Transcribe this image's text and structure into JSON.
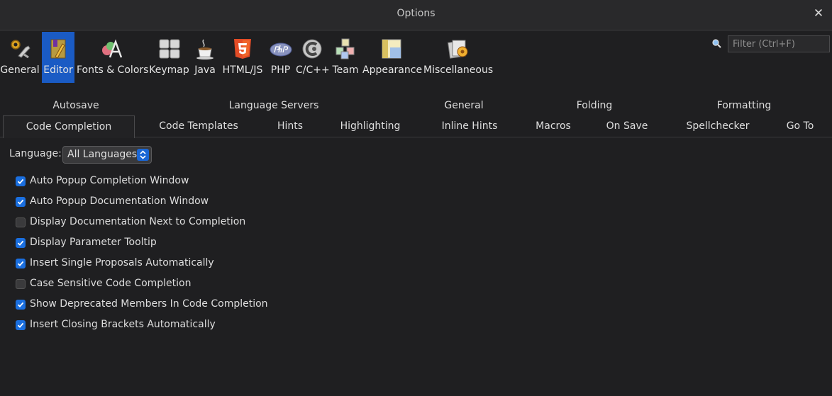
{
  "window": {
    "title": "Options",
    "close_glyph": "✕"
  },
  "toolbar": {
    "categories": [
      {
        "label": "General",
        "icon": "wrench-gear-icon"
      },
      {
        "label": "Editor",
        "icon": "editor-book-icon",
        "selected": true
      },
      {
        "label": "Fonts & Colors",
        "icon": "font-palette-icon"
      },
      {
        "label": "Keymap",
        "icon": "keyboard-icon"
      },
      {
        "label": "Java",
        "icon": "java-cup-icon"
      },
      {
        "label": "HTML/JS",
        "icon": "html5-icon"
      },
      {
        "label": "PHP",
        "icon": "php-icon"
      },
      {
        "label": "C/C++",
        "icon": "cpp-icon"
      },
      {
        "label": "Team",
        "icon": "team-cubes-icon"
      },
      {
        "label": "Appearance",
        "icon": "appearance-layout-icon"
      },
      {
        "label": "Miscellaneous",
        "icon": "misc-cards-icon"
      }
    ],
    "filter_placeholder": "Filter (Ctrl+F)"
  },
  "tabs": {
    "row1": [
      "Autosave",
      "Language Servers",
      "General",
      "Folding",
      "Formatting"
    ],
    "row2": [
      "Code Completion",
      "Code Templates",
      "Hints",
      "Highlighting",
      "Inline Hints",
      "Macros",
      "On Save",
      "Spellchecker",
      "Go To"
    ],
    "active": "Code Completion"
  },
  "language": {
    "label": "Language:",
    "value": "All Languages"
  },
  "options": [
    {
      "label": "Auto Popup Completion Window",
      "checked": true
    },
    {
      "label": "Auto Popup Documentation Window",
      "checked": true
    },
    {
      "label": "Display Documentation Next to Completion",
      "checked": false
    },
    {
      "label": "Display Parameter Tooltip",
      "checked": true
    },
    {
      "label": "Insert Single Proposals Automatically",
      "checked": true
    },
    {
      "label": "Case Sensitive Code Completion",
      "checked": false
    },
    {
      "label": "Show Deprecated Members In Code Completion",
      "checked": true
    },
    {
      "label": "Insert Closing Brackets Automatically",
      "checked": true
    }
  ],
  "colors": {
    "accent": "#1a6fe0",
    "selected_category": "#1a5bc4",
    "background": "#1f1f21"
  }
}
